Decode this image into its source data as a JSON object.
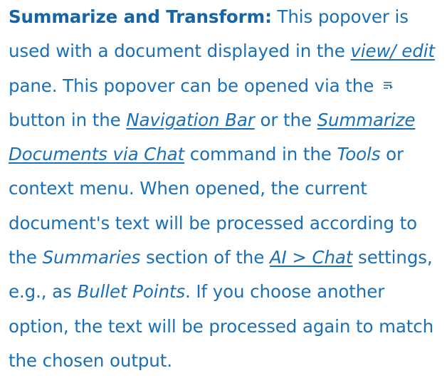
{
  "paragraph": {
    "bold_title": "Summarize and Transform:",
    "t1": " This popover is used with a document displayed in the ",
    "link_view_edit": "view/ edit",
    "t2": " pane. This popover can be opened via the ",
    "icon_name": "summarize-list-icon",
    "t3": "button in the ",
    "link_navigation_bar": "Navigation Bar",
    "t4": " or the ",
    "link_summarize_docs": "Summarize Documents via Chat",
    "t5": " command in the ",
    "italic_tools": "Tools",
    "t6": " or context menu. When opened, the current document's text will be processed according to the ",
    "italic_summaries": "Summaries",
    "t7": " section of the ",
    "link_ai_chat": "AI > Chat",
    "t8": " settings, e.g., as ",
    "italic_bullet_points": "Bullet Points",
    "t9": ". If you choose another option, the text will be processed again to match the chosen output."
  },
  "colors": {
    "text": "#1a6fb5",
    "background": "#ffffff"
  }
}
